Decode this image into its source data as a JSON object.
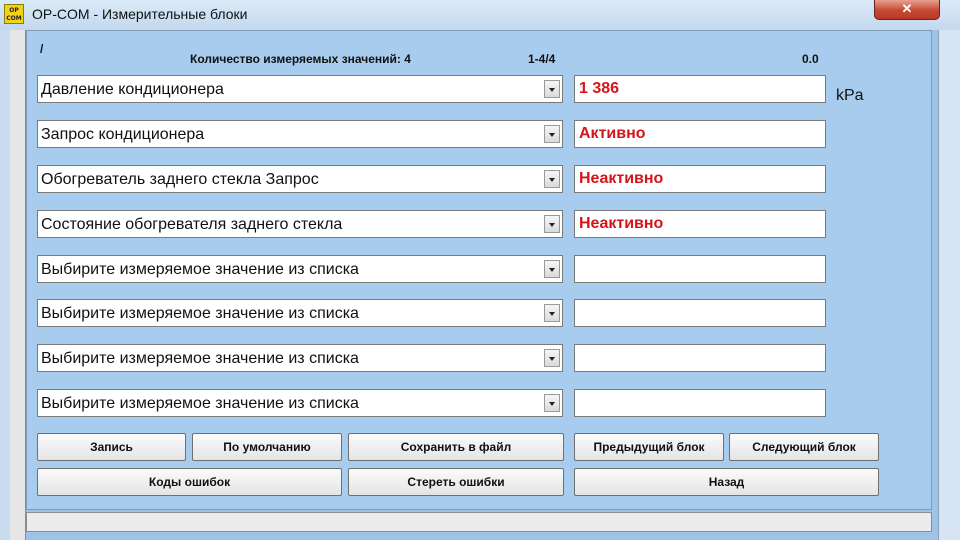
{
  "window": {
    "icon_text": "OP COM",
    "title": "OP-COM - Измерительные блоки",
    "close_symbol": "✕"
  },
  "header": {
    "slash": "/",
    "count_label": "Количество измеряемых значений: 4",
    "range": "1-4/4",
    "time_value": "0.0"
  },
  "rows": [
    {
      "selector": "Давление кондиционера",
      "value": "1 386",
      "unit": "kPa"
    },
    {
      "selector": "Запрос кондиционера",
      "value": "Активно"
    },
    {
      "selector": "Обогреватель заднего стекла Запрос",
      "value": "Неактивно"
    },
    {
      "selector": "Состояние обогревателя заднего стекла",
      "value": "Неактивно"
    },
    {
      "selector": "Выбирите измеряемое значение из списка",
      "value": ""
    },
    {
      "selector": "Выбирите измеряемое значение из списка",
      "value": ""
    },
    {
      "selector": "Выбирите измеряемое значение из списка",
      "value": ""
    },
    {
      "selector": "Выбирите измеряемое значение из списка",
      "value": ""
    }
  ],
  "buttons": {
    "record": "Запись",
    "default": "По умолчанию",
    "save_file": "Сохранить в файл",
    "prev_block": "Предыдущий блок",
    "next_block": "Следующий блок",
    "error_codes": "Коды ошибок",
    "clear_errors": "Стереть ошибки",
    "back": "Назад"
  },
  "colors": {
    "value_text": "#d5141b",
    "panel_background": "#a7ccee"
  }
}
